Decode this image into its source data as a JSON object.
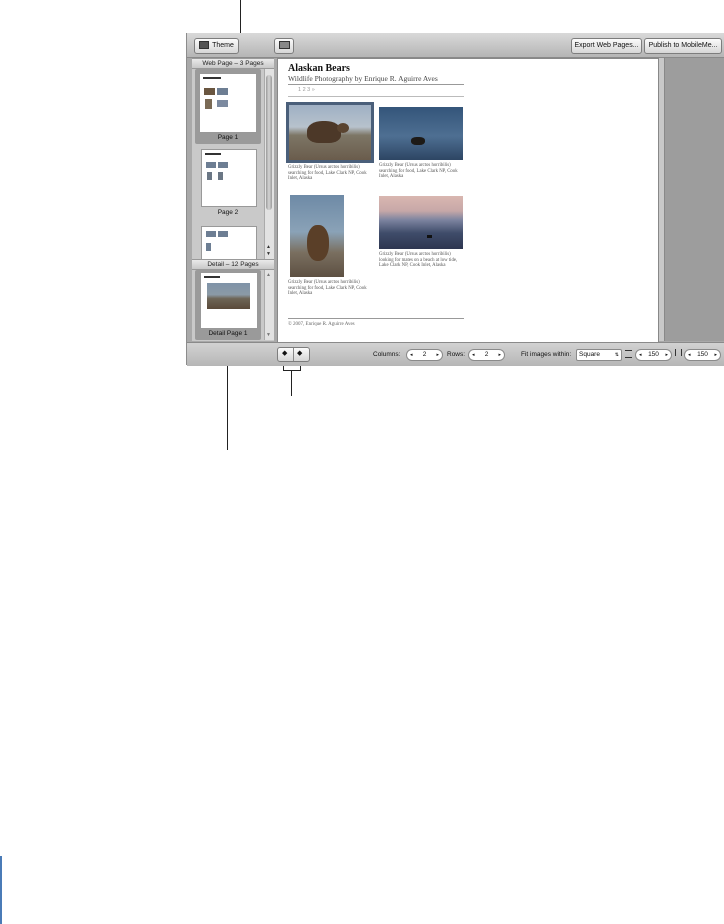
{
  "toolbar": {
    "theme_label": "Theme",
    "export_label": "Export Web Pages...",
    "publish_label": "Publish to MobileMe..."
  },
  "sidebar": {
    "webpage_header": "Web Page – 3 Pages",
    "pages": [
      "Page 1",
      "Page 2"
    ],
    "detail_header": "Detail – 12 Pages",
    "detail_page": "Detail Page 1"
  },
  "page": {
    "title": "Alaskan Bears",
    "subtitle": "Wildlife Photography by Enrique R. Aguirre Aves",
    "pager": "1  2  3  »",
    "captions": [
      "Grizzly Bear (Ursus arctos horribilis) searching for food, Lake Clark NP, Cook Inlet, Alaska",
      "Grizzly Bear (Ursus arctos horribilis) searching for food, Lake Clark NP, Cook Inlet, Alaska",
      "Grizzly Bear (Ursus arctos horribilis) searching for food, Lake Clark NP, Cook Inlet, Alaska",
      "Grizzly Bear (Ursus arctos horribilis) looking for mates on a beach at low tide, Lake Clark NP, Cook Inlet, Alaska"
    ],
    "footer": "© 2007, Enrique R. Aguirre Aves"
  },
  "bottom": {
    "columns_label": "Columns:",
    "columns_value": "2",
    "rows_label": "Rows:",
    "rows_value": "2",
    "fit_label": "Fit images within:",
    "fit_value": "Square",
    "width_value": "150",
    "height_value": "150"
  },
  "colors": {
    "selection": "#9a9a9a",
    "photo_border": "#4a5f7a"
  }
}
